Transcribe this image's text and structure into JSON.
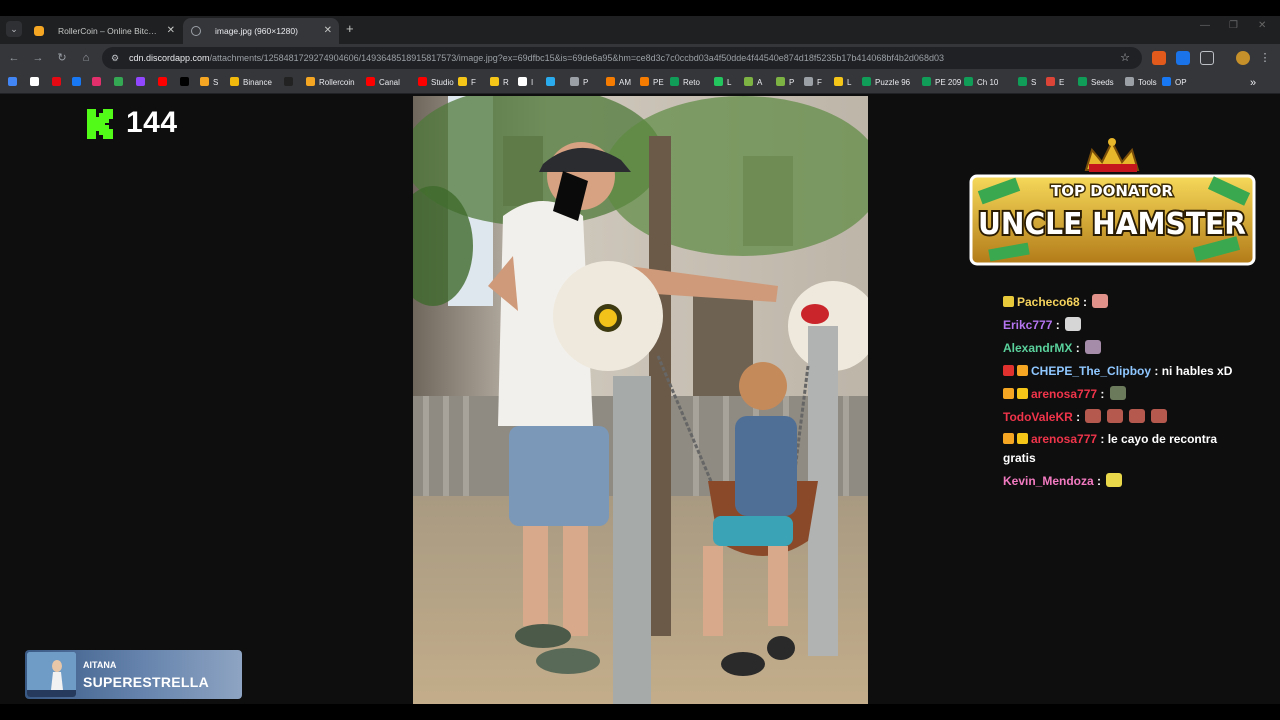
{
  "browser": {
    "tabs": [
      {
        "label": "RollerCoin – Online Bitcoin Mining Simulator",
        "favicon_color": "#f5a623",
        "active": false
      },
      {
        "label": "image.jpg (960×1280)",
        "favicon_color": "#9aa0a6",
        "active": true
      }
    ],
    "new_tab_symbol": "+",
    "url_host": "cdn.discordapp.com",
    "url_path": "/attachments/1258481729274904606/1493648518915817573/image.jpg?ex=69dfbc15&is=69de6a95&hm=ce8d3c7c0ccbd03a4f50dde4f44540e874d18f5235b17b414068bf4b2d068d03",
    "bookmarks": [
      {
        "label": "",
        "color": "#4285f4"
      },
      {
        "label": "",
        "color": "#ffffff"
      },
      {
        "label": "",
        "color": "#e50914"
      },
      {
        "label": "",
        "color": "#1877f2"
      },
      {
        "label": "",
        "color": "#e1306c"
      },
      {
        "label": "",
        "color": "#34a853"
      },
      {
        "label": "",
        "color": "#9146ff"
      },
      {
        "label": "",
        "color": "#ff0000"
      },
      {
        "label": "",
        "color": "#000000"
      },
      {
        "label": "S",
        "color": "#f5a623"
      },
      {
        "label": "Binance",
        "color": "#f0b90b"
      },
      {
        "label": "",
        "color": "#222222"
      },
      {
        "label": "Rollercoin",
        "color": "#f5a623"
      },
      {
        "label": "Canal",
        "color": "#ff0000"
      },
      {
        "label": "Studio",
        "color": "#ff0000"
      },
      {
        "label": "F",
        "color": "#f5c518"
      },
      {
        "label": "R",
        "color": "#f5c518"
      },
      {
        "label": "I",
        "color": "#ffffff"
      },
      {
        "label": "",
        "color": "#2aabee"
      },
      {
        "label": "P",
        "color": "#9aa0a6"
      },
      {
        "label": "AM",
        "color": "#f57c00"
      },
      {
        "label": "PE",
        "color": "#f57c00"
      },
      {
        "label": "Reto",
        "color": "#0f9d58"
      },
      {
        "label": "L",
        "color": "#22c55e"
      },
      {
        "label": "A",
        "color": "#7cb342"
      },
      {
        "label": "P",
        "color": "#7cb342"
      },
      {
        "label": "F",
        "color": "#9aa0a6"
      },
      {
        "label": "L",
        "color": "#f5c518"
      },
      {
        "label": "Puzzle 96",
        "color": "#0f9d58"
      },
      {
        "label": "PE 209",
        "color": "#0f9d58"
      },
      {
        "label": "Ch 10",
        "color": "#0f9d58"
      },
      {
        "label": "S",
        "color": "#0f9d58"
      },
      {
        "label": "E",
        "color": "#db4437"
      },
      {
        "label": "Seeds",
        "color": "#0f9d58"
      },
      {
        "label": "Tools",
        "color": "#9aa0a6"
      },
      {
        "label": "OP",
        "color": "#1877f2"
      }
    ],
    "more_symbol": "»"
  },
  "overlay": {
    "kick_viewers": "144",
    "kick_color": "#53fc18",
    "top_donator_label": "TOP DONATOR",
    "top_donator_name": "UNCLE HAMSTER"
  },
  "chat": [
    {
      "user": "Pacheco68",
      "user_color": "#f5d35c",
      "text": "",
      "badges": [
        "#e8c93a"
      ],
      "emotes": [
        "#e0928a"
      ]
    },
    {
      "user": "Erikc777",
      "user_color": "#b574f0",
      "text": "",
      "badges": [],
      "emotes": [
        "#d6d6d6"
      ]
    },
    {
      "user": "AlexandrMX",
      "user_color": "#5ad19b",
      "text": "",
      "badges": [],
      "emotes": [
        "#a58ca8"
      ]
    },
    {
      "user": "CHEPE_The_Clipboy",
      "user_color": "#8fc7ff",
      "text": "ni hables xD",
      "badges": [
        "#e0312f",
        "#f5a623"
      ],
      "emotes": []
    },
    {
      "user": "arenosa777",
      "user_color": "#f0344a",
      "text": "",
      "badges": [
        "#f5a623",
        "#f5c518"
      ],
      "emotes": [
        "#6b7a5a"
      ]
    },
    {
      "user": "TodoValeKR",
      "user_color": "#f0344a",
      "text": "",
      "badges": [],
      "emotes": [
        "#b5594e",
        "#b5594e",
        "#b5594e",
        "#b5594e"
      ]
    },
    {
      "user": "arenosa777",
      "user_color": "#f0344a",
      "text": "le cayo de recontra gratis",
      "badges": [
        "#f5a623",
        "#f5c518"
      ],
      "emotes": []
    },
    {
      "user": "Kevin_Mendoza",
      "user_color": "#f27ac0",
      "text": "",
      "badges": [],
      "emotes": [
        "#e8d84a"
      ]
    }
  ],
  "now_playing": {
    "artist": "AITANA",
    "title": "SUPERESTRELLA"
  }
}
